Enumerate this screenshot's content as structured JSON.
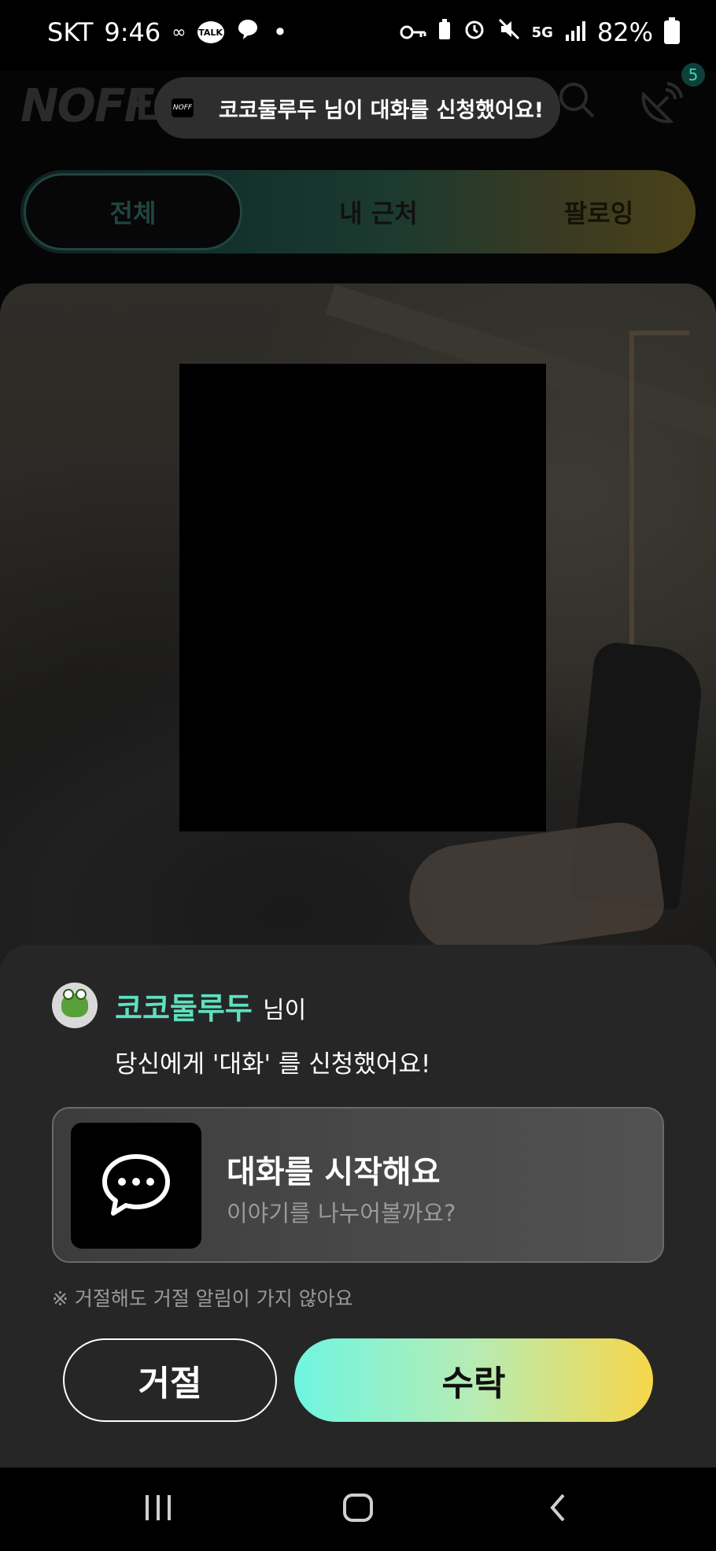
{
  "status_bar": {
    "carrier": "SKT",
    "time": "9:46",
    "talk_label": "TALK",
    "network": "5G",
    "battery": "82%"
  },
  "header": {
    "logo_text": "NOFF",
    "partial_title": "L",
    "badge_count": "5"
  },
  "toast": {
    "logo_text": "NOFF",
    "message": "코코둘루두 님이 대화를 신청했어요!"
  },
  "tabs": [
    {
      "label": "전체",
      "active": true
    },
    {
      "label": "내 근처",
      "active": false
    },
    {
      "label": "팔로잉",
      "active": false
    }
  ],
  "request": {
    "sender_name": "코코둘루두",
    "sender_suffix": "님이",
    "message": "당신에게 '대화' 를 신청했어요!",
    "card_title": "대화를 시작해요",
    "card_subtitle": "이야기를 나누어볼까요?",
    "notice": "※ 거절해도 거절 알림이 가지 않아요",
    "reject_label": "거절",
    "accept_label": "수락"
  },
  "colors": {
    "accent_name": "#5ee0c0",
    "accept_gradient_start": "#6ff5e0",
    "accept_gradient_end": "#f7d64a",
    "sheet_bg": "#262626"
  },
  "icons": {
    "toast": "app-logo-icon",
    "header": [
      "search-icon",
      "satellite-dish-icon"
    ],
    "card": "chat-bubble-icon",
    "nav": [
      "recent-apps-icon",
      "home-icon",
      "back-icon"
    ]
  }
}
